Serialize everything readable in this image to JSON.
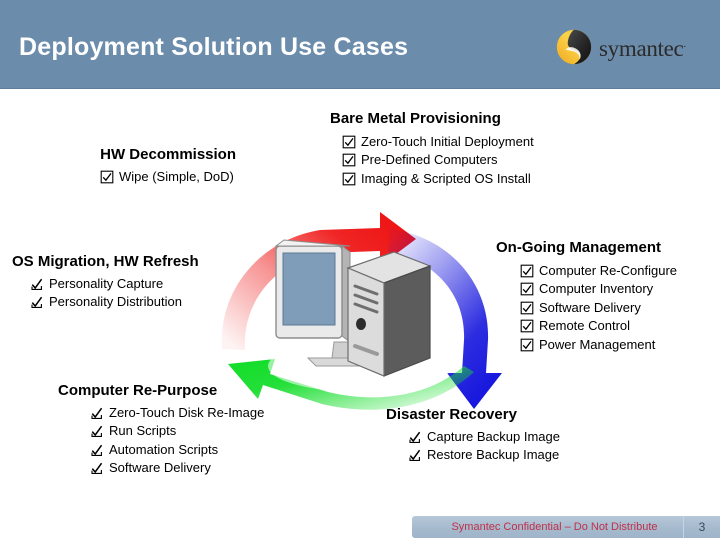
{
  "header": {
    "title": "Deployment Solution Use Cases",
    "band_color": "#6c8cab",
    "title_color": "#ffffff",
    "brand": {
      "wordmark": "symantec",
      "trademark": ".",
      "mark_gold": "#f5c43c",
      "mark_dark": "#2f2f2f"
    }
  },
  "blocks": {
    "hw_decommission": {
      "heading": "HW Decommission",
      "items": [
        {
          "label": "Wipe (Simple, DoD)",
          "icon": "checked-box-icon"
        }
      ]
    },
    "bare_metal": {
      "heading": "Bare Metal Provisioning",
      "items": [
        {
          "label": "Zero-Touch Initial Deployment",
          "icon": "checked-box-icon"
        },
        {
          "label": "Pre-Defined Computers",
          "icon": "checked-box-icon"
        },
        {
          "label": "Imaging & Scripted OS Install",
          "icon": "checked-box-icon"
        }
      ]
    },
    "os_migration": {
      "heading": "OS Migration, HW Refresh",
      "items": [
        {
          "label": "Personality Capture",
          "icon": "check-mark-box-icon"
        },
        {
          "label": "Personality Distribution",
          "icon": "check-mark-box-icon"
        }
      ]
    },
    "ongoing_management": {
      "heading": "On-Going Management",
      "items": [
        {
          "label": "Computer Re-Configure",
          "icon": "checked-box-icon"
        },
        {
          "label": "Computer Inventory",
          "icon": "checked-box-icon"
        },
        {
          "label": "Software Delivery",
          "icon": "checked-box-icon"
        },
        {
          "label": "Remote Control",
          "icon": "checked-box-icon"
        },
        {
          "label": "Power Management",
          "icon": "checked-box-icon"
        }
      ]
    },
    "computer_repurpose": {
      "heading": "Computer Re-Purpose",
      "items": [
        {
          "label": "Zero-Touch Disk Re-Image",
          "icon": "check-mark-box-icon"
        },
        {
          "label": "Run Scripts",
          "icon": "check-mark-box-icon"
        },
        {
          "label": "Automation Scripts",
          "icon": "check-mark-box-icon"
        },
        {
          "label": "Software Delivery",
          "icon": "check-mark-box-icon"
        }
      ]
    },
    "disaster_recovery": {
      "heading": "Disaster Recovery",
      "items": [
        {
          "label": "Capture Backup Image",
          "icon": "check-mark-box-icon"
        },
        {
          "label": "Restore Backup Image",
          "icon": "check-mark-box-icon"
        }
      ]
    }
  },
  "diagram": {
    "name": "lifecycle-cycle-diagram",
    "arrows": [
      {
        "name": "red-arrow",
        "color": "#ee1111",
        "direction": "clockwise-top-left-to-top-right"
      },
      {
        "name": "blue-arrow",
        "color": "#1515dd",
        "direction": "clockwise-top-right-to-bottom-right"
      },
      {
        "name": "green-arrow",
        "color": "#14dd2a",
        "direction": "counterclockwise-bottom-right-to-bottom-left"
      }
    ],
    "center_icons": [
      "desktop-monitor-icon",
      "tower-computer-icon"
    ]
  },
  "footer": {
    "confidential_text": "Symantec Confidential – Do Not Distribute",
    "page_number": "3",
    "bar_color": "#a6bace",
    "text_color": "#c0304a"
  }
}
